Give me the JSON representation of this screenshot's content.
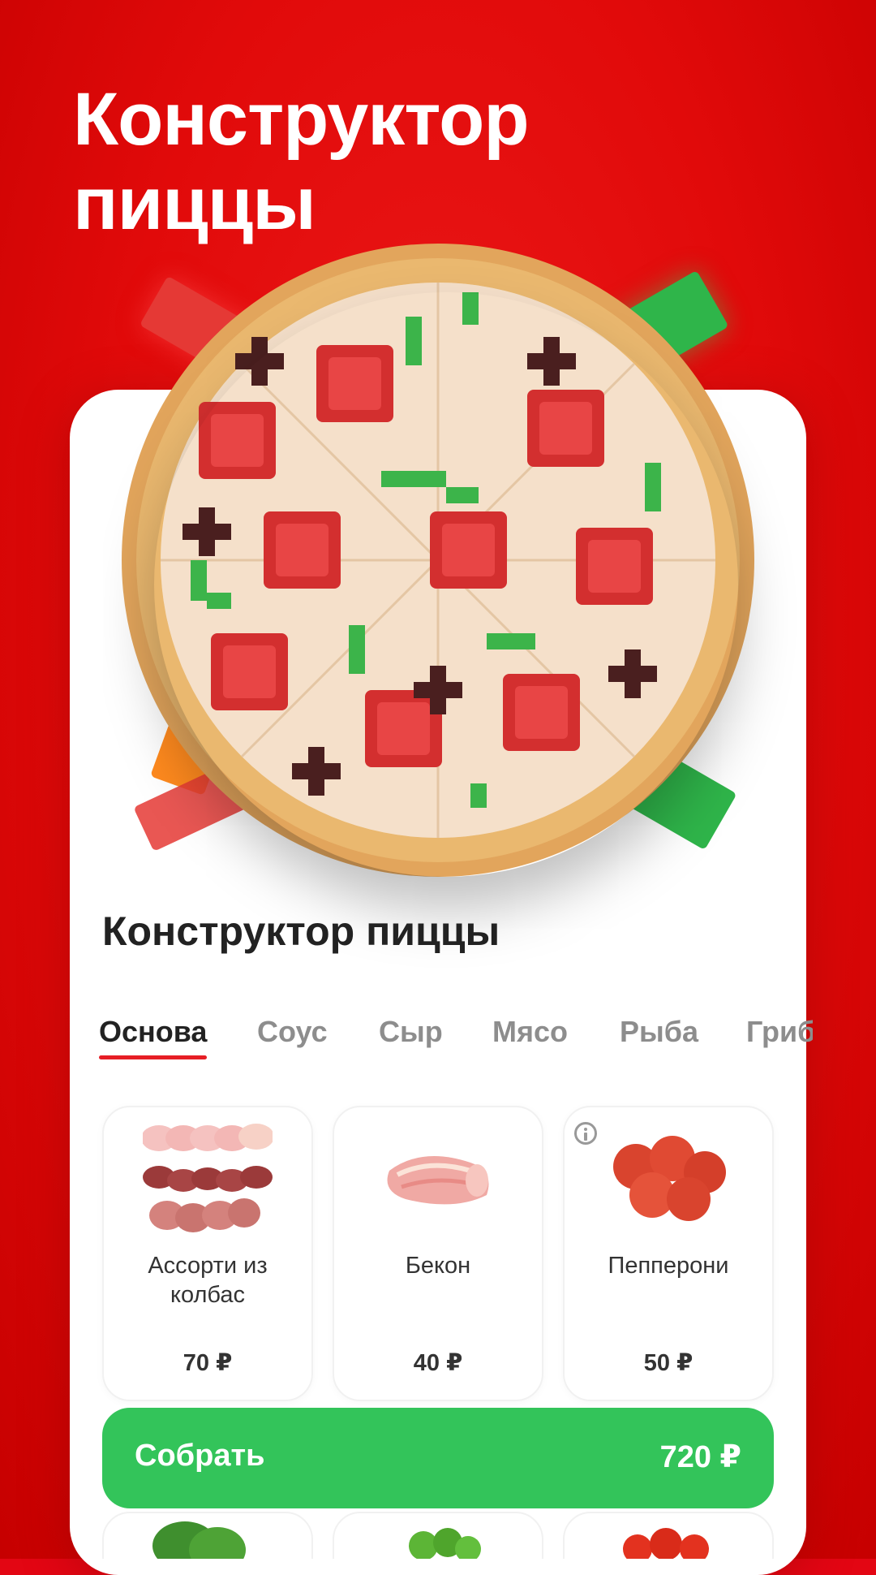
{
  "hero": {
    "title_line1": "Конструктор",
    "title_line2": "пиццы"
  },
  "section": {
    "title": "Конструктор пиццы"
  },
  "tabs": [
    {
      "label": "Основа",
      "active": true
    },
    {
      "label": "Соус",
      "active": false
    },
    {
      "label": "Сыр",
      "active": false
    },
    {
      "label": "Мясо",
      "active": false
    },
    {
      "label": "Рыба",
      "active": false
    },
    {
      "label": "Грибы",
      "active": false
    }
  ],
  "products": [
    {
      "name": "Ассорти из колбас",
      "price": "70 ₽",
      "icon": "sausage-assortment-image"
    },
    {
      "name": "Бекон",
      "price": "40 ₽",
      "icon": "bacon-image"
    },
    {
      "name": "Пепперони",
      "price": "50 ₽",
      "icon": "pepperoni-image",
      "info": true
    }
  ],
  "action": {
    "label": "Собрать",
    "total": "720 ₽"
  },
  "colors": {
    "brand_red": "#e30613",
    "accent_green": "#33c45a",
    "tab_active_underline": "#e61e25"
  }
}
